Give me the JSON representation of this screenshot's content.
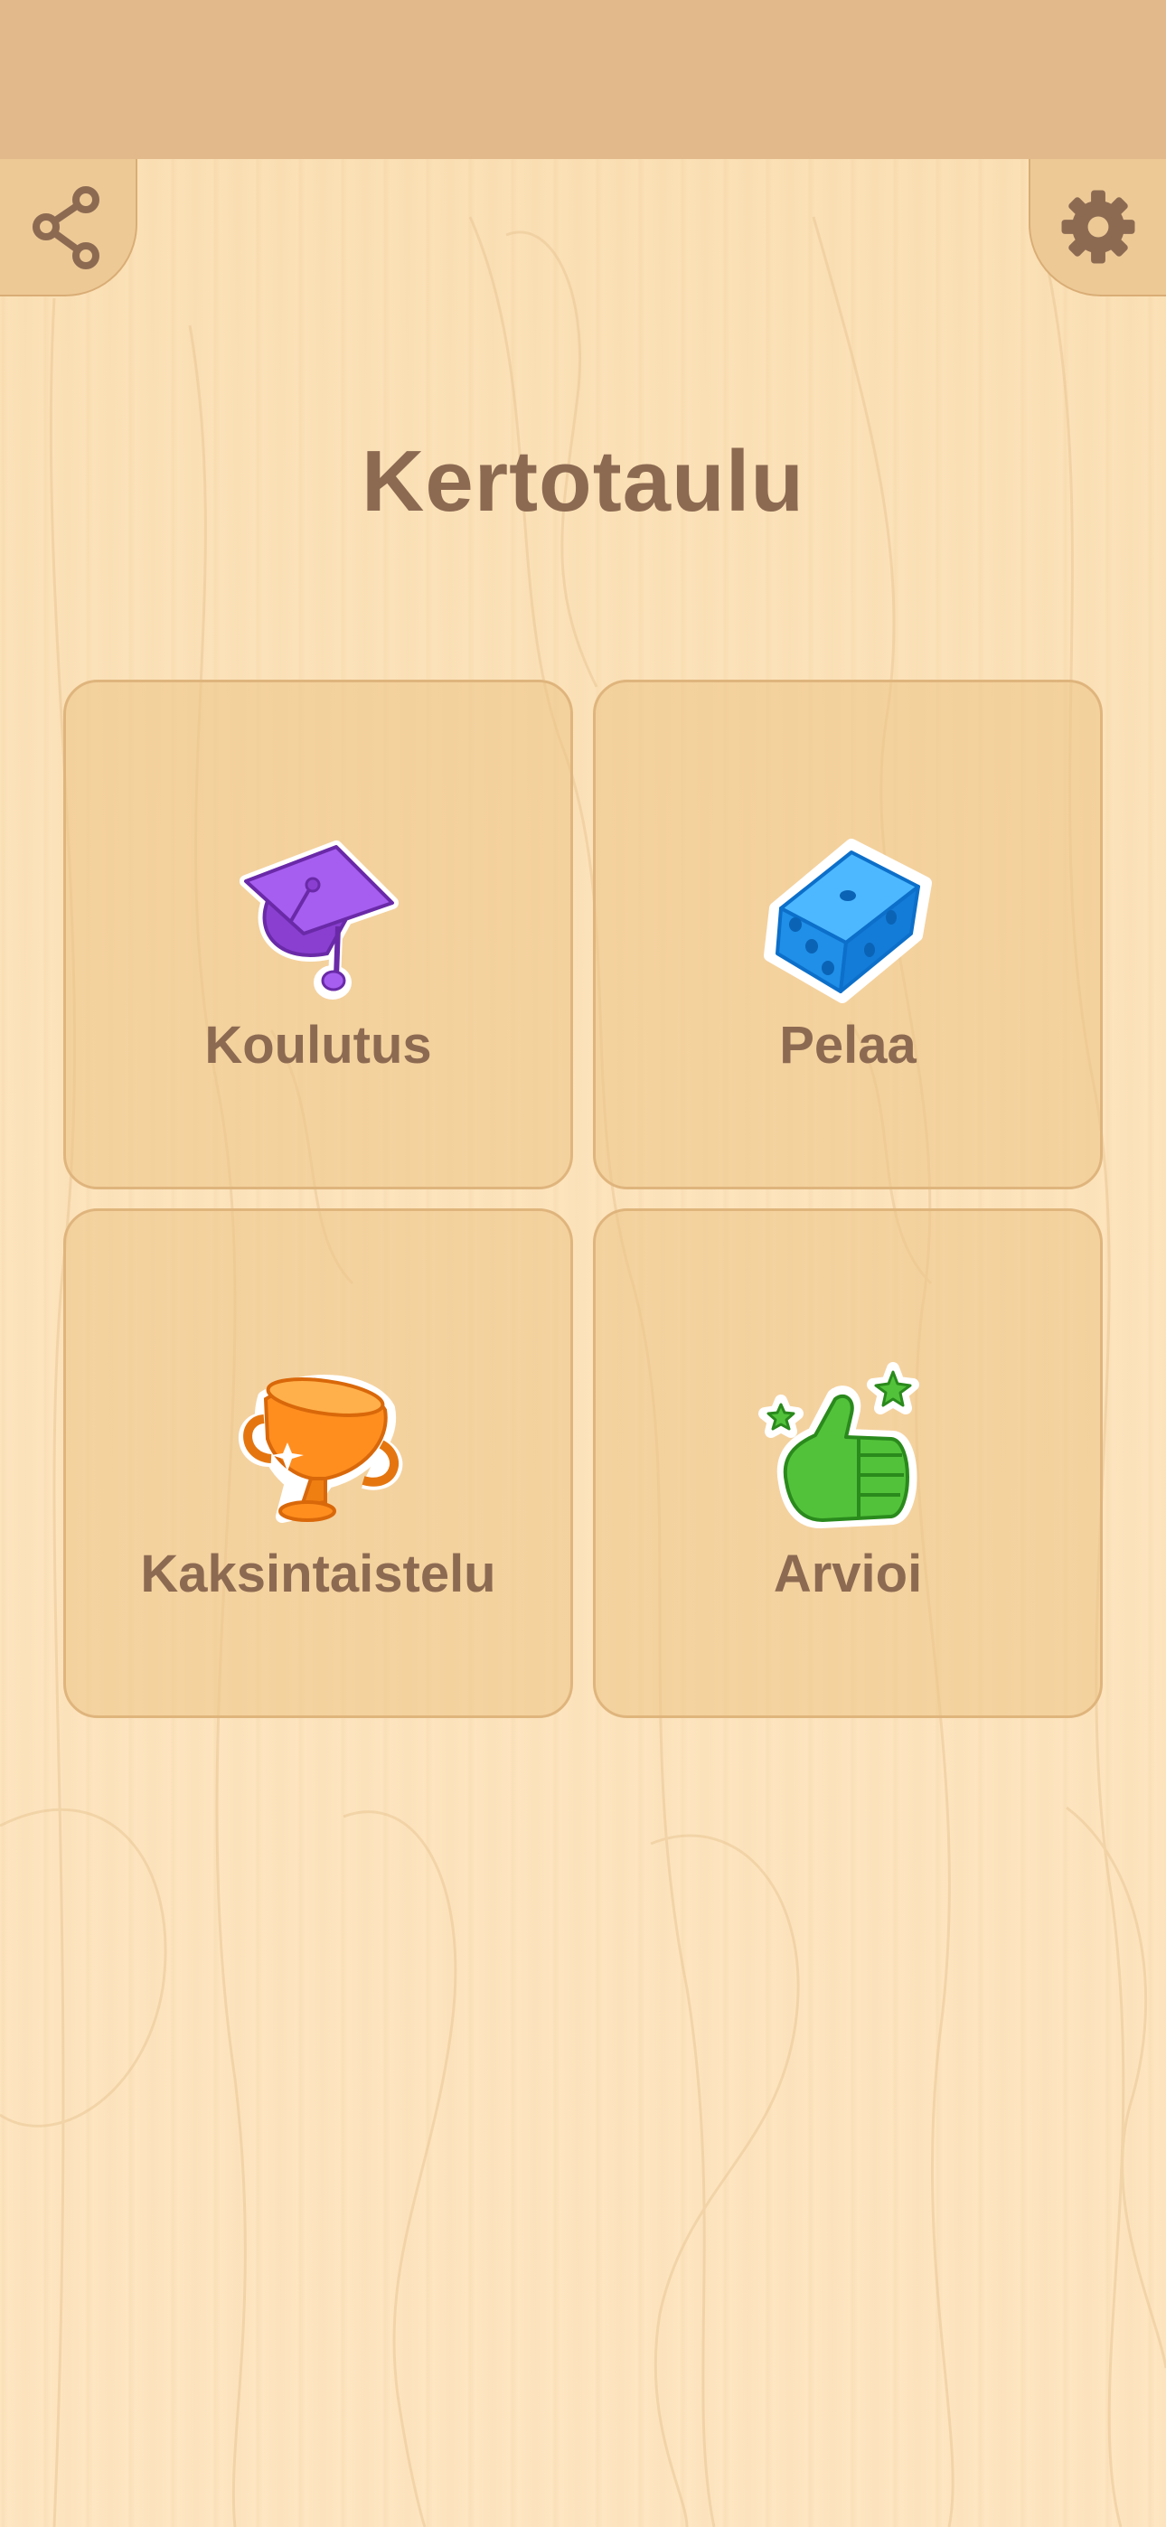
{
  "header": {
    "title": "Kertotaulu",
    "share_icon": "share-icon",
    "settings_icon": "gear-icon"
  },
  "menu": {
    "items": [
      {
        "label": "Koulutus",
        "icon": "graduation-cap-icon"
      },
      {
        "label": "Pelaa",
        "icon": "dice-icon"
      },
      {
        "label": "Kaksintaistelu",
        "icon": "trophy-icon"
      },
      {
        "label": "Arvioi",
        "icon": "thumbs-up-icon"
      }
    ]
  },
  "colors": {
    "background": "#fde5bf",
    "status_bar": "#e1b98a",
    "text": "#8c6a52",
    "tile": "#edc996"
  }
}
